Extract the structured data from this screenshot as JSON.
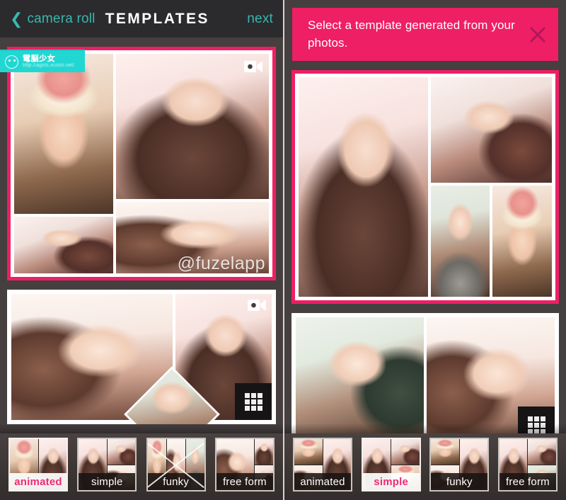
{
  "left_panel": {
    "nav": {
      "back_icon": "chevron-left-icon",
      "back_label": "camera roll",
      "title": "TEMPLATES",
      "next_label": "next"
    },
    "watermark": {
      "icon": "cat-face-icon",
      "title": "電脳少女",
      "url": "http://agirls.xcolor.net/"
    },
    "collages": [
      {
        "selected": true,
        "video_badge": "video-camera-icon",
        "watermark_text": "@fuzelapp",
        "layout": "2-column mosaic"
      },
      {
        "selected": false,
        "video_badge": "video-camera-icon",
        "grid_badge": "grid-3x3-icon",
        "layout": "wide pair with tilted overlay"
      }
    ],
    "templates": [
      {
        "label": "animated",
        "selected": true
      },
      {
        "label": "simple",
        "selected": false
      },
      {
        "label": "funky",
        "selected": false
      },
      {
        "label": "free form",
        "selected": false
      }
    ]
  },
  "right_panel": {
    "banner": {
      "message": "Select a template generated from your photos.",
      "close_icon": "close-x-icon"
    },
    "collages": [
      {
        "selected": true,
        "layout": "one large left, three right"
      },
      {
        "selected": false,
        "grid_badge": "grid-3x3-icon",
        "layout": "two-up pair"
      }
    ],
    "templates": [
      {
        "label": "animated",
        "selected": false
      },
      {
        "label": "simple",
        "selected": true
      },
      {
        "label": "funky",
        "selected": false
      },
      {
        "label": "free form",
        "selected": false
      }
    ]
  },
  "colors": {
    "accent_pink": "#ee1f64",
    "accent_teal": "#3ab6ad",
    "watermark_cyan": "#22d7d2",
    "nav_background": "#2b2b2d",
    "panel_background": "#453f40"
  }
}
